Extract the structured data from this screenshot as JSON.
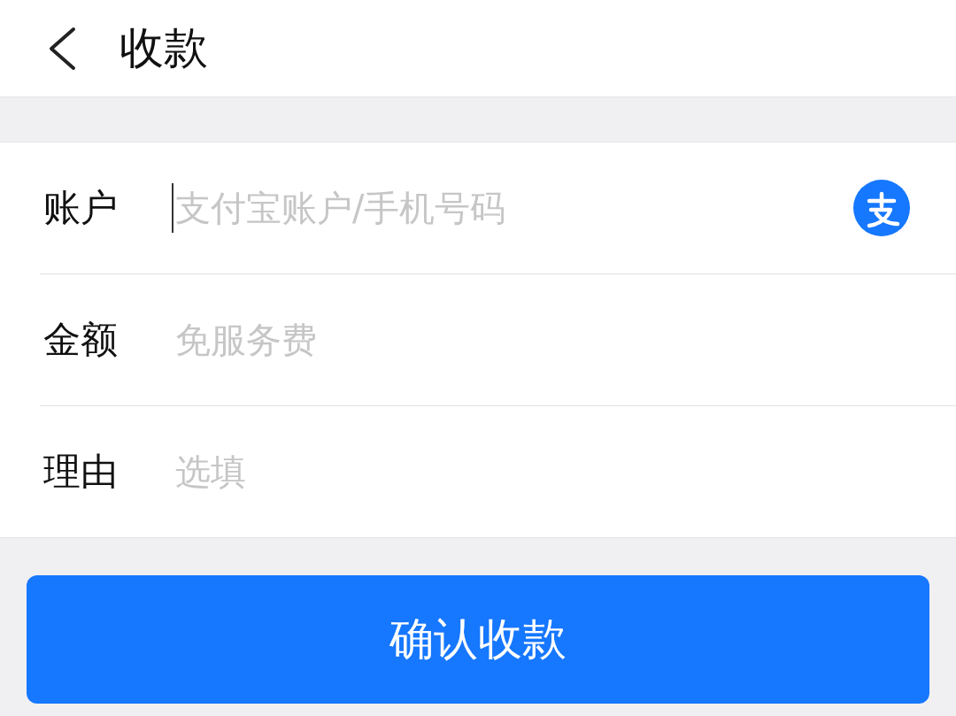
{
  "header": {
    "title": "收款"
  },
  "fields": [
    {
      "label": "账户",
      "placeholder": "支付宝账户/手机号码",
      "focused": true,
      "kind": "account"
    },
    {
      "label": "金额",
      "placeholder": "免服务费",
      "focused": false,
      "kind": "plain"
    },
    {
      "label": "理由",
      "placeholder": "选填",
      "focused": false,
      "kind": "plain"
    }
  ],
  "confirm_button": {
    "label": "确认收款"
  }
}
